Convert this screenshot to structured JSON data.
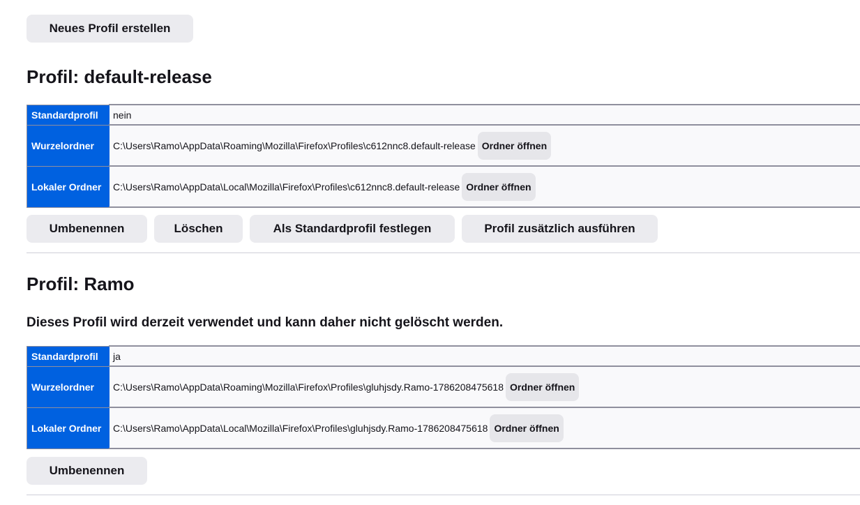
{
  "new_profile_button": "Neues Profil erstellen",
  "profiles": [
    {
      "title": "Profil: default-release",
      "rows": {
        "default": {
          "label": "Standardprofil",
          "value": "nein"
        },
        "root": {
          "label": "Wurzelordner",
          "value": "C:\\Users\\Ramo\\AppData\\Roaming\\Mozilla\\Firefox\\Profiles\\c612nnc8.default-release",
          "button": "Ordner öffnen"
        },
        "local": {
          "label": "Lokaler Ordner",
          "value": "C:\\Users\\Ramo\\AppData\\Local\\Mozilla\\Firefox\\Profiles\\c612nnc8.default-release",
          "button": "Ordner öffnen"
        }
      },
      "actions": {
        "rename": "Umbenennen",
        "delete": "Löschen",
        "set_default": "Als Standardprofil festlegen",
        "launch": "Profil zusätzlich ausführen"
      }
    },
    {
      "title": "Profil: Ramo",
      "notice": "Dieses Profil wird derzeit verwendet und kann daher nicht gelöscht werden.",
      "rows": {
        "default": {
          "label": "Standardprofil",
          "value": "ja"
        },
        "root": {
          "label": "Wurzelordner",
          "value": "C:\\Users\\Ramo\\AppData\\Roaming\\Mozilla\\Firefox\\Profiles\\gluhjsdy.Ramo-1786208475618",
          "button": "Ordner öffnen"
        },
        "local": {
          "label": "Lokaler Ordner",
          "value": "C:\\Users\\Ramo\\AppData\\Local\\Mozilla\\Firefox\\Profiles\\gluhjsdy.Ramo-1786208475618",
          "button": "Ordner öffnen"
        }
      },
      "actions": {
        "rename": "Umbenennen"
      }
    }
  ],
  "colors": {
    "header_cell": "#0061e0",
    "button_bg": "#ebebef",
    "cell_bg": "#f9f9fb"
  }
}
